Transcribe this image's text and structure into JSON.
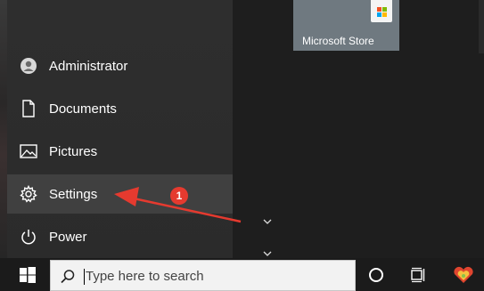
{
  "start_menu": {
    "items": [
      {
        "label": "Administrator",
        "icon": "user-avatar-icon"
      },
      {
        "label": "Documents",
        "icon": "document-icon"
      },
      {
        "label": "Pictures",
        "icon": "pictures-icon"
      },
      {
        "label": "Settings",
        "icon": "gear-icon",
        "active": true
      },
      {
        "label": "Power",
        "icon": "power-icon"
      }
    ]
  },
  "tiles": {
    "store": {
      "label": "Microsoft Store",
      "icon": "store-bag-icon",
      "color": "#6f7980"
    }
  },
  "annotation": {
    "number": "1",
    "color": "#e53a2f"
  },
  "taskbar": {
    "search_placeholder": "Type here to search",
    "icons": [
      "windows-logo-icon",
      "search-icon",
      "cortana-circle-icon",
      "task-view-icon",
      "app-heart-icon"
    ]
  }
}
